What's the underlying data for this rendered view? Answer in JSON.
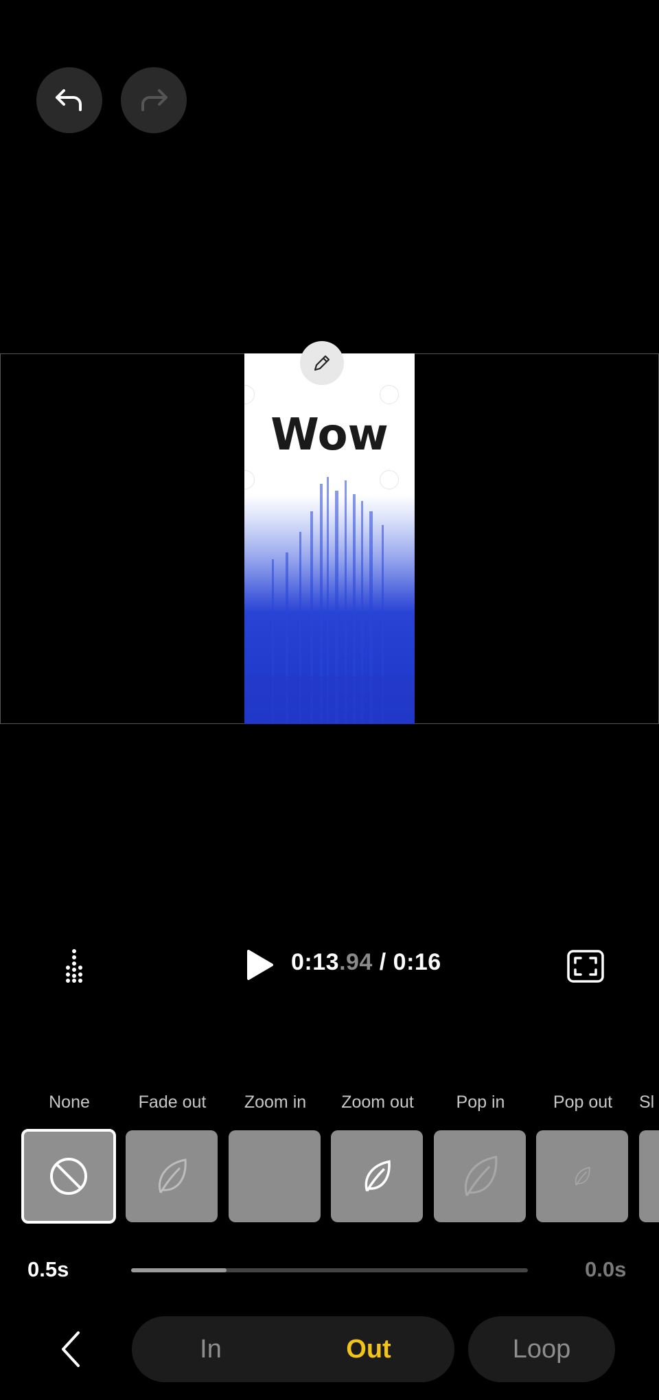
{
  "header": {
    "undo_icon": "undo-arrow-icon",
    "redo_icon": "redo-arrow-icon"
  },
  "preview": {
    "clip_text": "Wow",
    "edit_icon": "pencil-icon"
  },
  "playback": {
    "time_main": "0:13",
    "time_fraction": ".94",
    "time_total": " / 0:16",
    "play_icon": "play-icon",
    "menu_icon": "dots-menu-icon",
    "fullscreen_icon": "fullscreen-icon"
  },
  "effects": [
    {
      "label": "None",
      "icon": "none-icon",
      "selected": true
    },
    {
      "label": "Fade out",
      "icon": "leaf-icon"
    },
    {
      "label": "Zoom in",
      "icon": ""
    },
    {
      "label": "Zoom out",
      "icon": "leaf-icon"
    },
    {
      "label": "Pop in",
      "icon": "leaf-icon"
    },
    {
      "label": "Pop out",
      "icon": "leaf-icon"
    },
    {
      "label": "Sl",
      "icon": ""
    }
  ],
  "duration": {
    "current": "0.5s",
    "max": "0.0s",
    "progress": 0.24
  },
  "nav": {
    "back_icon": "back-chevron-icon",
    "tab_in": "In",
    "tab_out": "Out",
    "tab_loop": "Loop",
    "accent": "#f2c31b"
  }
}
